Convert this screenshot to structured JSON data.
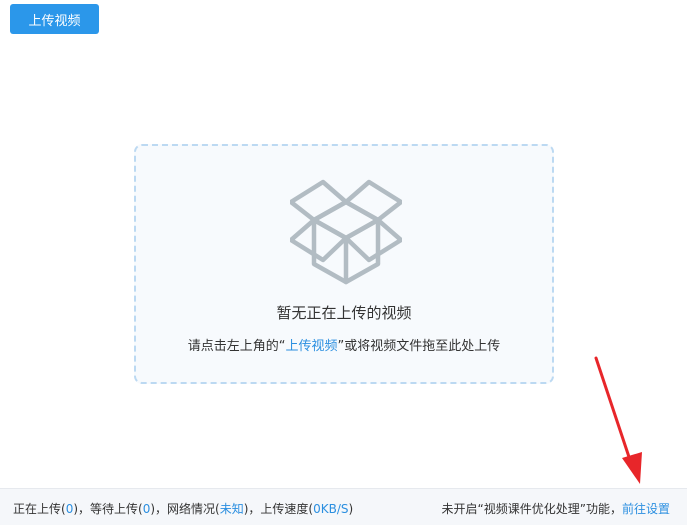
{
  "toolbar": {
    "upload_label": "上传视频"
  },
  "dropzone": {
    "title": "暂无正在上传的视频",
    "hint_prefix": "请点击左上角的“",
    "hint_link": "上传视频",
    "hint_suffix": "”或将视频文件拖至此处上传",
    "icon": "open-box-icon"
  },
  "status": {
    "uploading_label": "正在上传(",
    "uploading_count": "0",
    "waiting_label": ")，等待上传(",
    "waiting_count": "0",
    "network_label": ")，网络情况(",
    "network_value": "未知",
    "speed_label": ")，上传速度(",
    "speed_value": "0KB/S",
    "speed_close": ")",
    "optimize_text": "未开启“视频课件优化处理”功能，",
    "settings_link": "前往设置"
  },
  "colors": {
    "accent": "#2b97ea",
    "link": "#2b8fe0",
    "annotation_arrow": "#e8262a"
  }
}
